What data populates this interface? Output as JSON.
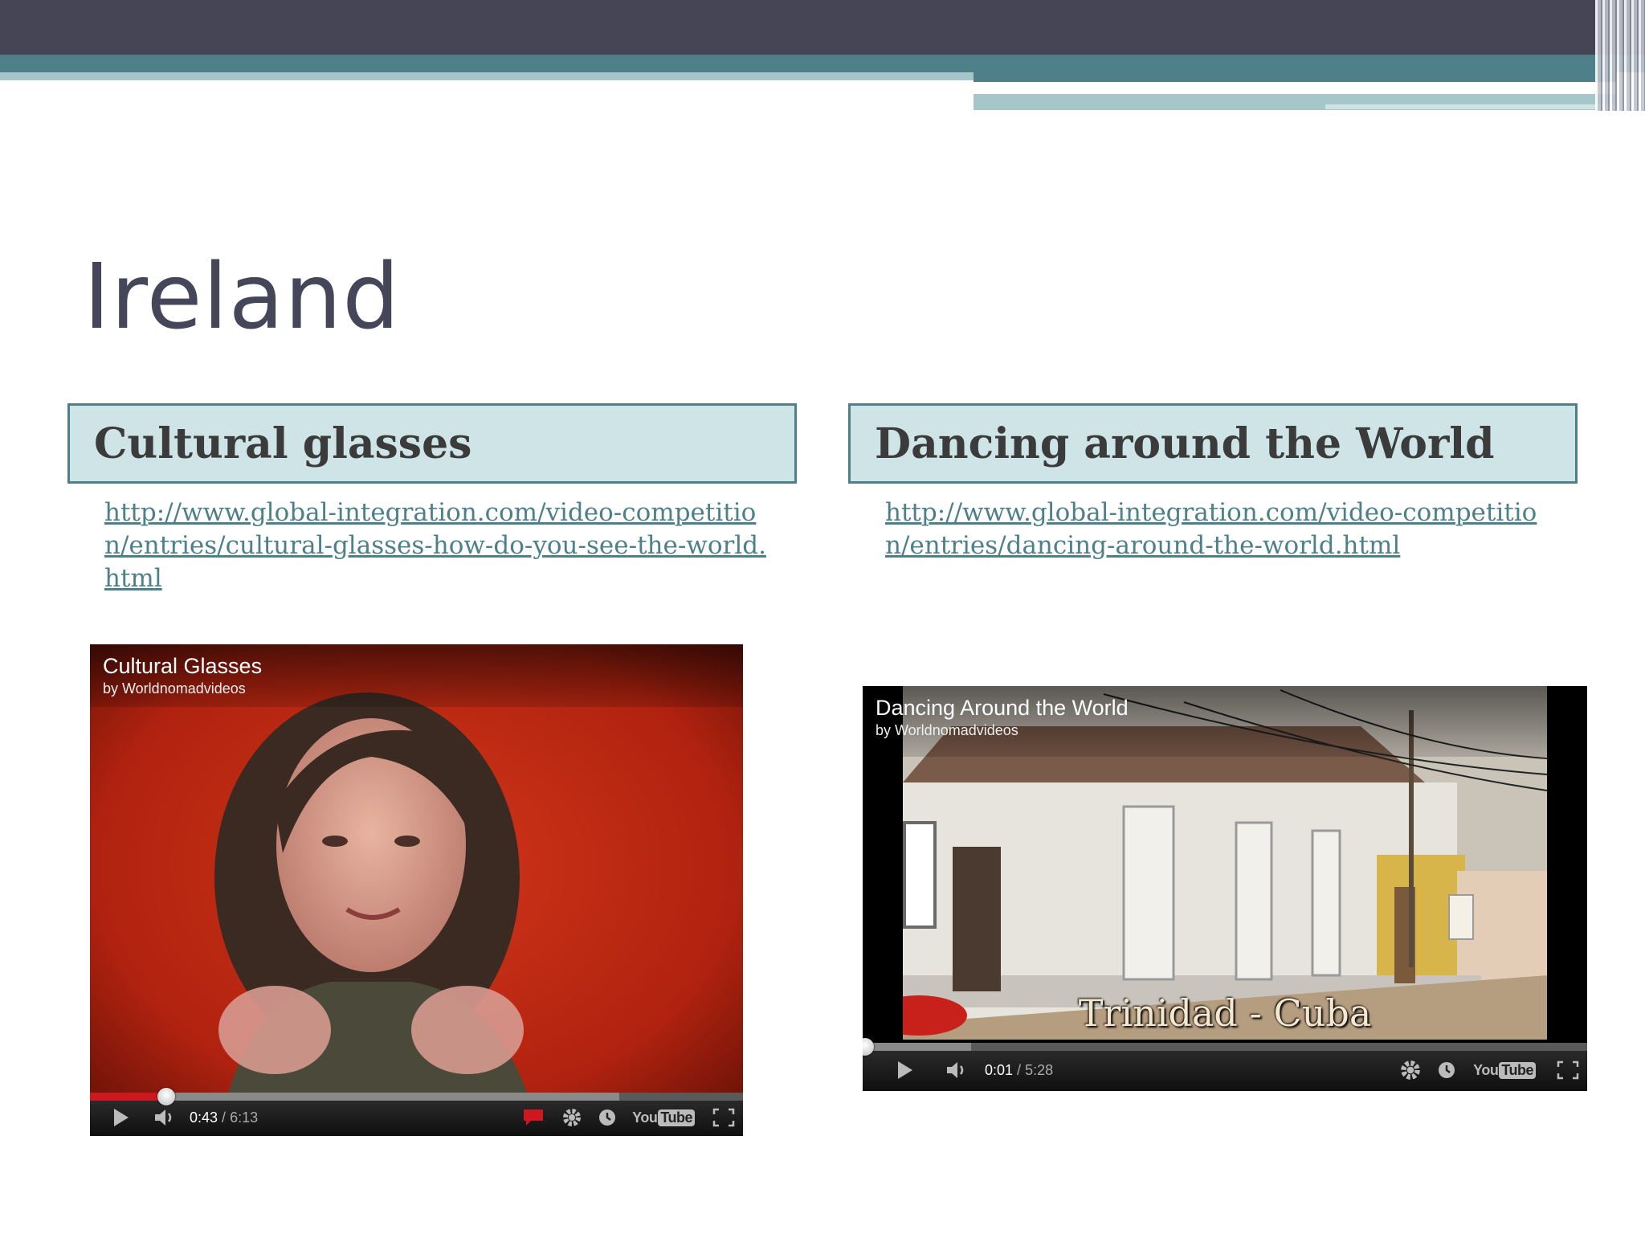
{
  "slide": {
    "title": "Ireland"
  },
  "columns": [
    {
      "header": "Cultural glasses",
      "link": "http://www.global-integration.com/video-competition/entries/cultural-glasses-how-do-you-see-the-world.html",
      "video": {
        "title": "Cultural Glasses",
        "byline": "by Worldnomadvideos",
        "time_current": "0:43",
        "time_separator": " / ",
        "time_total": "6:13",
        "progress_fraction": 0.117,
        "buffer_fraction": 0.81
      }
    },
    {
      "header": "Dancing around the World",
      "link": "http://www.global-integration.com/video-competition/entries/dancing-around-the-world.html",
      "video": {
        "title": "Dancing Around the World",
        "byline": "by Worldnomadvideos",
        "caption": "Trinidad - Cuba",
        "time_current": "0:01",
        "time_separator": " / ",
        "time_total": "5:28",
        "progress_fraction": 0.003,
        "buffer_fraction": 0.15
      }
    }
  ],
  "player_controls": {
    "icons": [
      "play-icon",
      "volume-icon",
      "annotation-icon",
      "settings-icon",
      "watch-later-icon",
      "youtube-logo",
      "fullscreen-icon"
    ],
    "youtube_you": "You",
    "youtube_tube": "Tube"
  },
  "colors": {
    "banner_dark": "#464556",
    "banner_teal": "#4d8088",
    "banner_light": "#a6c6ca",
    "header_fill": "#cfe4e6",
    "link": "#4d8088",
    "title": "#45465a",
    "progress_red": "#cc181e"
  }
}
